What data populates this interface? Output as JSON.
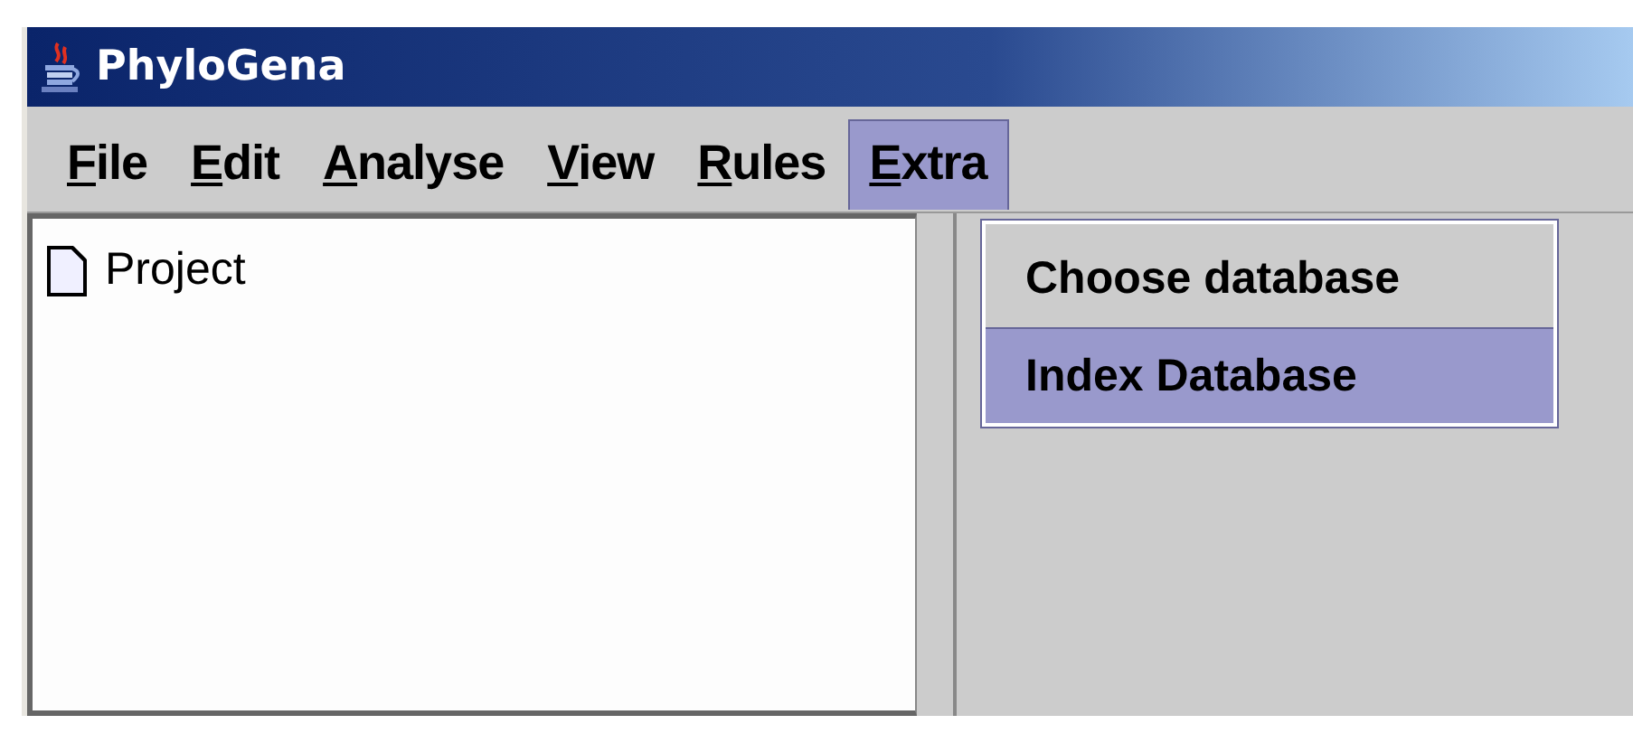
{
  "window": {
    "title": "PhyloGena"
  },
  "menu_bar": [
    {
      "label": "File",
      "selected": false
    },
    {
      "label": "Edit",
      "selected": false
    },
    {
      "label": "Analyse",
      "selected": false
    },
    {
      "label": "View",
      "selected": false
    },
    {
      "label": "Rules",
      "selected": false
    },
    {
      "label": "Extra",
      "selected": true
    }
  ],
  "open_menu": {
    "items": [
      {
        "label": "Choose database",
        "selected": false
      },
      {
        "label": "Index Database",
        "selected": true
      }
    ]
  },
  "tree": {
    "items": [
      {
        "label": "Project"
      }
    ]
  }
}
